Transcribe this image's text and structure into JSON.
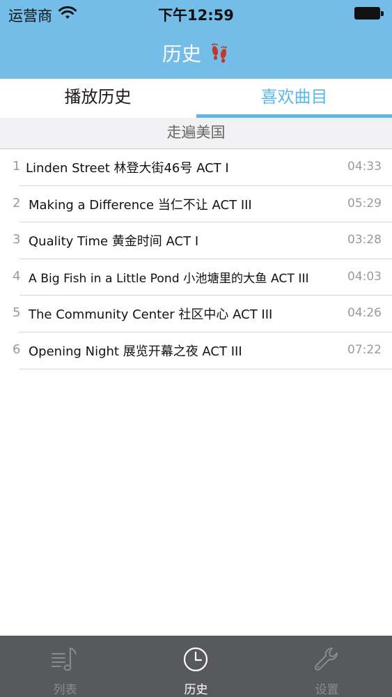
{
  "status_bar": {
    "carrier": "运营商",
    "time": "下午12:59"
  },
  "nav": {
    "title": "历史",
    "title_icon": "footprints-icon"
  },
  "tabs": [
    {
      "label": "播放历史",
      "selected": false
    },
    {
      "label": "喜欢曲目",
      "selected": true
    }
  ],
  "section": {
    "title": "走遍美国"
  },
  "tracks": [
    {
      "index": "1",
      "title": "Linden Street 林登大街46号 ACT I",
      "duration": "04:33"
    },
    {
      "index": "2",
      "title": "Making a Difference 当仁不让 ACT III",
      "duration": "05:29"
    },
    {
      "index": "3",
      "title": "Quality Time 黄金时间 ACT I",
      "duration": "03:28"
    },
    {
      "index": "4",
      "title": "A Big Fish in a Little Pond 小池塘里的大鱼 ACT III",
      "duration": "04:03"
    },
    {
      "index": "5",
      "title": "The Community Center 社区中心 ACT III",
      "duration": "04:26"
    },
    {
      "index": "6",
      "title": "Opening Night 展览开幕之夜 ACT III",
      "duration": "07:22"
    }
  ],
  "tabbar": [
    {
      "label": "列表",
      "icon": "music-list-icon",
      "active": false
    },
    {
      "label": "历史",
      "icon": "clock-icon",
      "active": true
    },
    {
      "label": "设置",
      "icon": "wrench-icon",
      "active": false
    }
  ],
  "colors": {
    "header": "#74bde9",
    "accent": "#5cb8e6",
    "tabbar": "#58595c"
  }
}
